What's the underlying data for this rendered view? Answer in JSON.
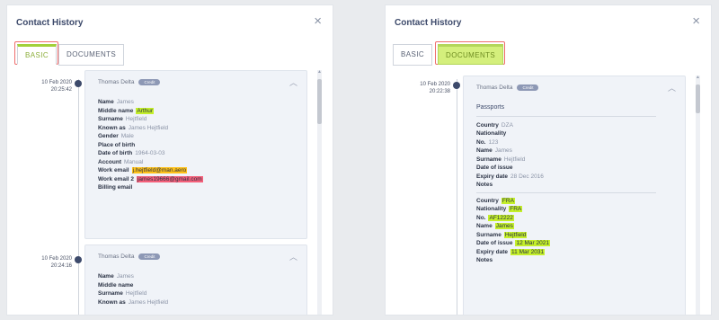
{
  "left": {
    "title": "Contact History",
    "close": "×",
    "tabs": [
      "BASIC",
      "DOCUMENTS"
    ],
    "entries": [
      {
        "date": "10 Feb 2020",
        "time": "20:25:42",
        "author": "Thomas Delta",
        "badge": "Credit",
        "fields": [
          {
            "label": "Name",
            "value": "James",
            "hl": ""
          },
          {
            "label": "Middle name",
            "value": "Arthur",
            "hl": "y"
          },
          {
            "label": "Surname",
            "value": "Hejtfield",
            "hl": ""
          },
          {
            "label": "Known as",
            "value": "James Hejtfield",
            "hl": ""
          },
          {
            "label": "Gender",
            "value": "Male",
            "hl": ""
          },
          {
            "label": "Place of birth",
            "value": "",
            "hl": ""
          },
          {
            "label": "Date of birth",
            "value": "1964-03-03",
            "hl": ""
          },
          {
            "label": "Account",
            "value": "Manual",
            "hl": ""
          },
          {
            "label": "Work email",
            "value": "j.hejtfield@man.aero",
            "hl": "o"
          },
          {
            "label": "Work email 2",
            "value": "james19666@gmail.com",
            "hl": "r"
          },
          {
            "label": "Billing email",
            "value": "",
            "hl": ""
          }
        ]
      },
      {
        "date": "10 Feb 2020",
        "time": "20:24:16",
        "author": "Thomas Delta",
        "badge": "Credit",
        "fields": [
          {
            "label": "Name",
            "value": "James",
            "hl": ""
          },
          {
            "label": "Middle name",
            "value": "",
            "hl": ""
          },
          {
            "label": "Surname",
            "value": "Hejtfield",
            "hl": ""
          },
          {
            "label": "Known as",
            "value": "James Hejtfield",
            "hl": ""
          }
        ]
      }
    ]
  },
  "right": {
    "title": "Contact History",
    "close": "×",
    "tabs": [
      "BASIC",
      "DOCUMENTS"
    ],
    "entry": {
      "date": "10 Feb 2020",
      "time": "20:22:38",
      "author": "Thomas Delta",
      "badge": "Credit",
      "section": "Passports",
      "passport1": [
        {
          "label": "Country",
          "value": "DZA",
          "hl": ""
        },
        {
          "label": "Nationality",
          "value": "",
          "hl": ""
        },
        {
          "label": "No.",
          "value": "123",
          "hl": ""
        },
        {
          "label": "Name",
          "value": "James",
          "hl": ""
        },
        {
          "label": "Surname",
          "value": "Hejtfield",
          "hl": ""
        },
        {
          "label": "Date of issue",
          "value": "",
          "hl": ""
        },
        {
          "label": "Expiry date",
          "value": "28 Dec 2016",
          "hl": ""
        },
        {
          "label": "Notes",
          "value": "",
          "hl": ""
        }
      ],
      "passport2": [
        {
          "label": "Country",
          "value": "FRA",
          "hl": "y"
        },
        {
          "label": "Nationality",
          "value": "FRA",
          "hl": "y"
        },
        {
          "label": "No.",
          "value": "AF12222",
          "hl": "y"
        },
        {
          "label": "Name",
          "value": "James",
          "hl": "y"
        },
        {
          "label": "Surname",
          "value": "Hejtfield",
          "hl": "y"
        },
        {
          "label": "Date of issue",
          "value": "12 Mar 2021",
          "hl": "y"
        },
        {
          "label": "Expiry date",
          "value": "11 Mar 2031",
          "hl": "y"
        },
        {
          "label": "Notes",
          "value": "",
          "hl": ""
        }
      ]
    }
  }
}
